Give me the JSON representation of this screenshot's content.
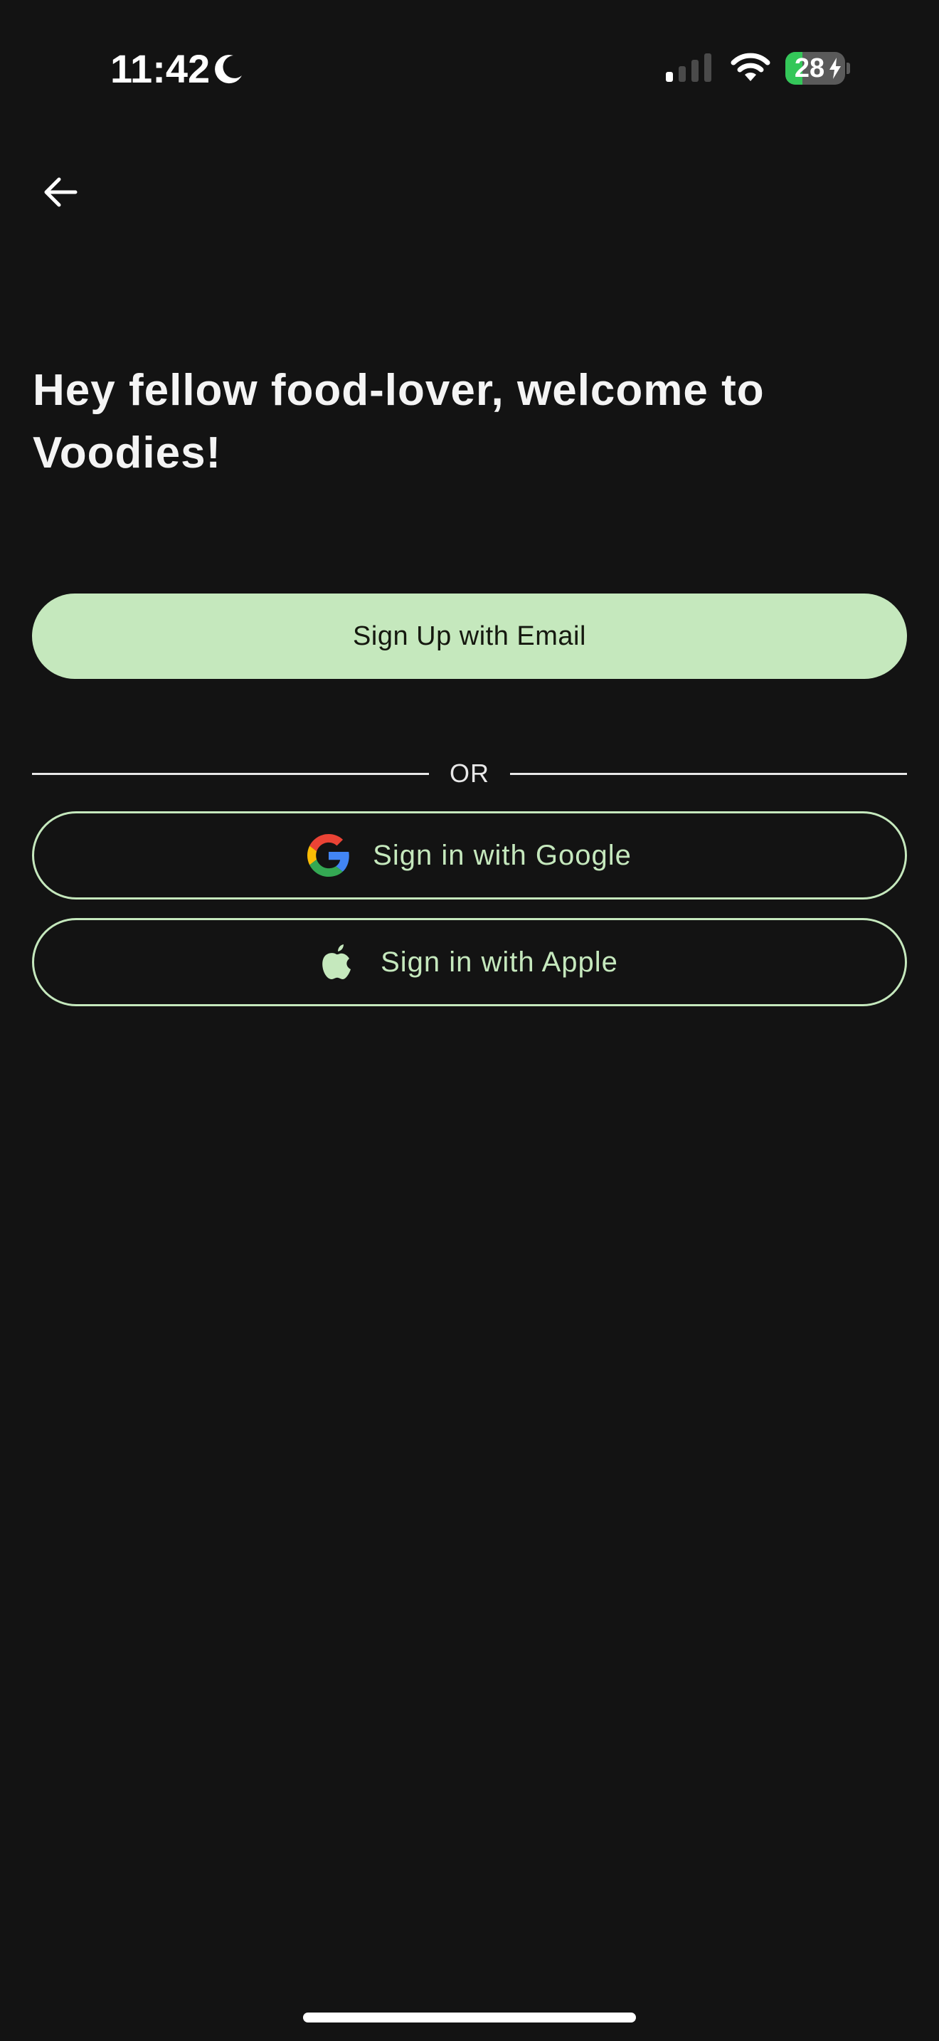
{
  "status_bar": {
    "time": "11:42",
    "battery_level": "28",
    "battery_fraction": 0.28,
    "icons": [
      "moon-icon",
      "cellular-signal-icon",
      "wifi-icon",
      "battery-charging-icon"
    ]
  },
  "nav": {
    "back_icon": "arrow-left-icon"
  },
  "welcome": {
    "title": "Hey fellow food-lover, welcome to Voodies!"
  },
  "actions": {
    "email_label": "Sign Up with Email",
    "divider_text": "OR",
    "google_label": "Sign in with Google",
    "google_icon": "google-icon",
    "apple_label": "Sign in with Apple",
    "apple_icon": "apple-icon"
  },
  "colors": {
    "background": "#131313",
    "accent": "#c5e8bd",
    "battery_green": "#34c759"
  }
}
